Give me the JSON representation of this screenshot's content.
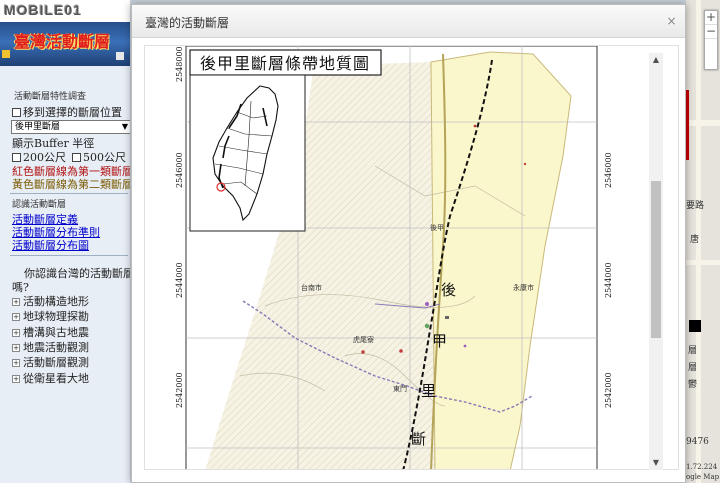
{
  "header": {
    "logo_text": "MOBILE01",
    "banner_title": "臺灣活動斷層"
  },
  "sidebar": {
    "section_survey": "活動斷層特性調查",
    "move_to_label": "移到選擇的斷層位置",
    "fault_select_value": "後甲里斷層",
    "buffer_label": "顯示Buffer 半徑",
    "buffer_200": "200公尺",
    "buffer_500": "500公尺",
    "legend_red": "紅色斷層線為第一類斷層",
    "legend_yellow": "黃色斷層線為第二類斷層",
    "section_learn": "認識活動斷層",
    "links": [
      "活動斷層定義",
      "活動斷層分布準則",
      "活動斷層分布圖"
    ],
    "question_line1": "你認識台灣的活動斷層",
    "question_line2": "嗎?",
    "tree_items": [
      "活動構造地形",
      "地球物理探勘",
      "槽溝與古地震",
      "地震活動觀測",
      "活動斷層觀測",
      "從衛星看大地"
    ]
  },
  "dialog": {
    "title": "臺灣的活動斷層",
    "close_glyph": "×",
    "scroll_up": "▲",
    "scroll_down": "▼"
  },
  "map": {
    "title": "後甲里斷層條帶地質圖",
    "y_ticks": [
      "2548000",
      "2546000",
      "2544000",
      "2542000"
    ],
    "fault_chars": [
      "後",
      "甲",
      "里",
      "斷"
    ],
    "place_labels": [
      "台南市",
      "永康市",
      "虎尾寮",
      "後甲",
      "東門"
    ]
  },
  "right_map": {
    "labels": [
      "要路",
      "唐",
      "層",
      "層",
      "鬱",
      "9476",
      "1.72.224",
      "ogle Map"
    ]
  },
  "colors": {
    "yellow_zone": "#fbf7cc",
    "hatch_zone": "#f4f0e0",
    "fault_line": "#111111",
    "boundary_line": "#b4a45a",
    "railway": "#8a78b6"
  }
}
